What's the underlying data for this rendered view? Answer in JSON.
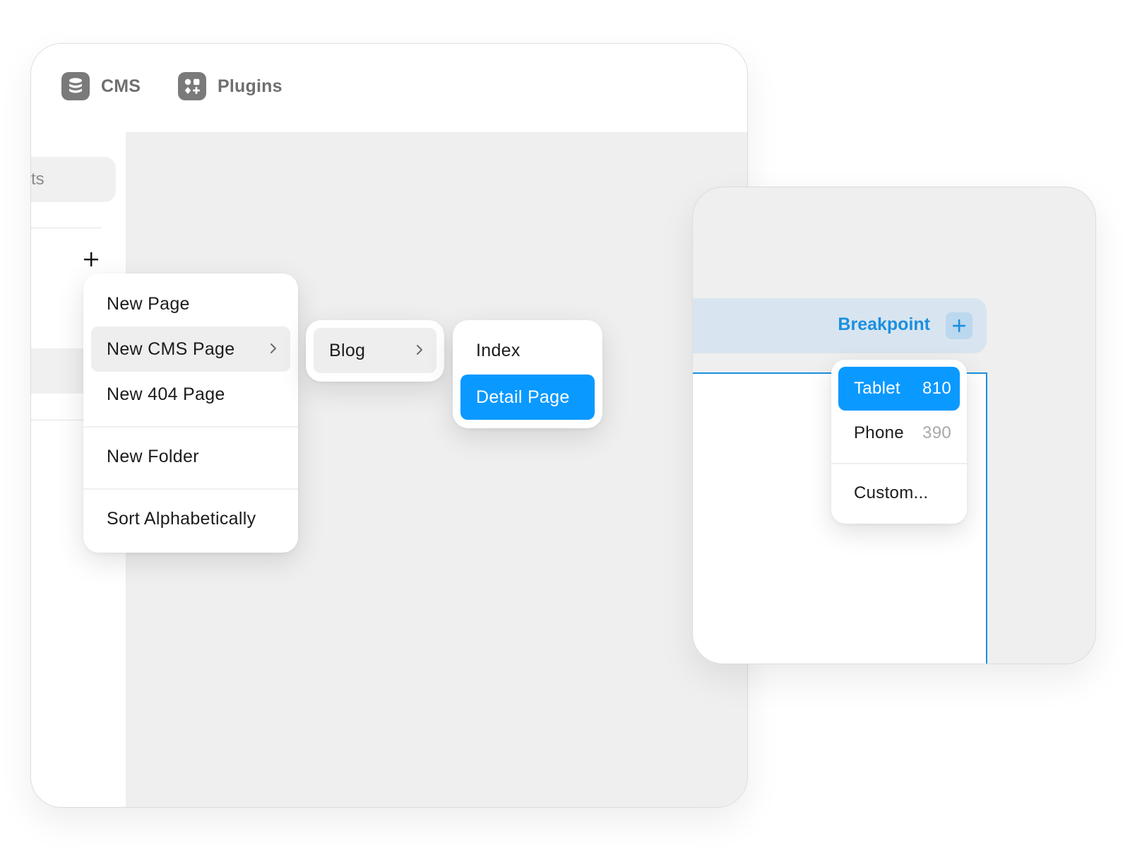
{
  "topbar": {
    "cms_label": "CMS",
    "plugins_label": "Plugins"
  },
  "sidebar": {
    "search_partial": "ts"
  },
  "page_menu": {
    "items": [
      "New Page",
      "New CMS Page",
      "New 404 Page",
      "New Folder",
      "Sort Alphabetically"
    ],
    "hovered": "New CMS Page"
  },
  "cms_menu": {
    "items": [
      "Blog"
    ]
  },
  "page_type_menu": {
    "items": [
      "Index",
      "Detail Page"
    ],
    "selected": "Detail Page"
  },
  "breakpoint": {
    "label": "Breakpoint",
    "options": [
      {
        "name": "Tablet",
        "value": "810"
      },
      {
        "name": "Phone",
        "value": "390"
      }
    ],
    "custom_label": "Custom...",
    "selected": "Tablet"
  },
  "colors": {
    "accent": "#0a99ff",
    "breakpoint_text": "#1b8fe0",
    "breakpoint_bar": "#d8e5f0",
    "canvas": "#efefef"
  },
  "icons": {
    "cms": "database-icon",
    "plugins": "plugins-grid-icon",
    "add": "plus-icon",
    "submenu": "chevron-right-icon"
  }
}
